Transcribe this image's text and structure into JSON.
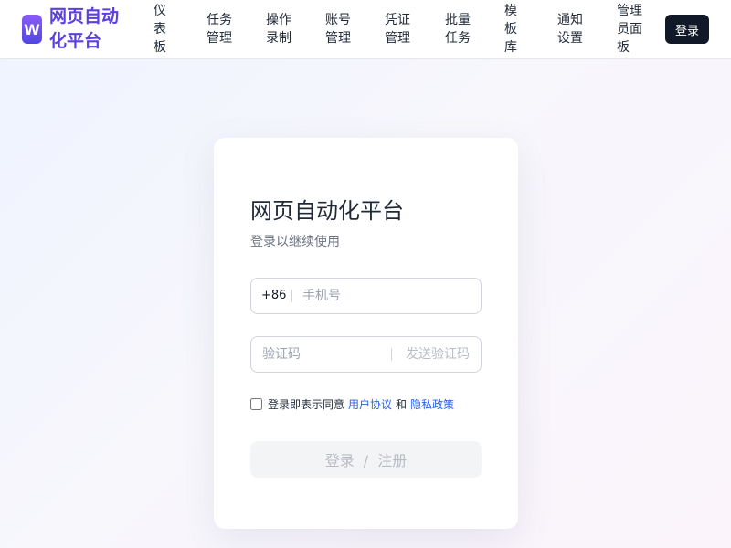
{
  "brand": {
    "logo_letter": "W",
    "name_line1": "网页自动",
    "name_line2": "化平台"
  },
  "nav": {
    "items": [
      {
        "lines": [
          "仪",
          "表",
          "板"
        ]
      },
      {
        "lines": [
          "任务",
          "管理"
        ]
      },
      {
        "lines": [
          "操作",
          "录制"
        ]
      },
      {
        "lines": [
          "账号",
          "管理"
        ]
      },
      {
        "lines": [
          "凭证",
          "管理"
        ]
      },
      {
        "lines": [
          "批量",
          "任务"
        ]
      },
      {
        "lines": [
          "模",
          "板",
          "库"
        ]
      },
      {
        "lines": [
          "通知",
          "设置"
        ]
      },
      {
        "lines": [
          "管理",
          "员面",
          "板"
        ]
      }
    ],
    "login_label": "登录"
  },
  "card": {
    "title": "网页自动化平台",
    "subtitle": "登录以继续使用",
    "phone": {
      "country_code": "+86",
      "placeholder": "手机号",
      "value": ""
    },
    "code": {
      "placeholder": "验证码",
      "value": "",
      "send_label": "发送验证码"
    },
    "agreement": {
      "checked": false,
      "prefix": "登录即表示同意",
      "terms_label": "用户协议",
      "and": "和",
      "privacy_label": "隐私政策"
    },
    "submit": {
      "login": "登录",
      "separator": "/",
      "register": "注册"
    }
  },
  "colors": {
    "accent": "#5b3fe0",
    "primary_dark": "#111827",
    "link": "#2563eb",
    "disabled_text": "#b8bcc4"
  }
}
